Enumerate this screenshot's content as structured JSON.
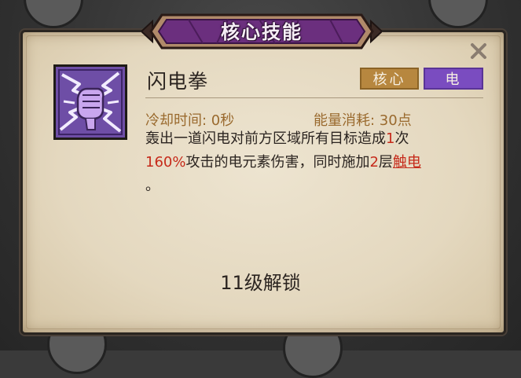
{
  "dialog": {
    "title": "核心技能",
    "close_symbol": "✕"
  },
  "skill": {
    "icon": "lightning-fist-icon",
    "name": "闪电拳",
    "tags": {
      "core": "核心",
      "element": "电"
    },
    "cooldown_text": "冷却时间: 0秒",
    "energy_text": "能量消耗: 30点",
    "description": {
      "line1_a": "轰出一道闪电对前方区域所有目标造成",
      "hit_count": "1",
      "line1_b": "次",
      "damage_percent": "160%",
      "line2_a": "攻击的电元素伤害，同时施加",
      "stack_count": "2",
      "line2_b": "层",
      "status_link": "触电",
      "line3": "。"
    },
    "unlock_text": "11级解锁"
  },
  "colors": {
    "banner_purple": "#6b2f7e",
    "tag_core": "#b7873f",
    "tag_electric": "#7a4cc0",
    "highlight_red": "#c62a1a",
    "stat_orange": "#9a6a2e"
  }
}
